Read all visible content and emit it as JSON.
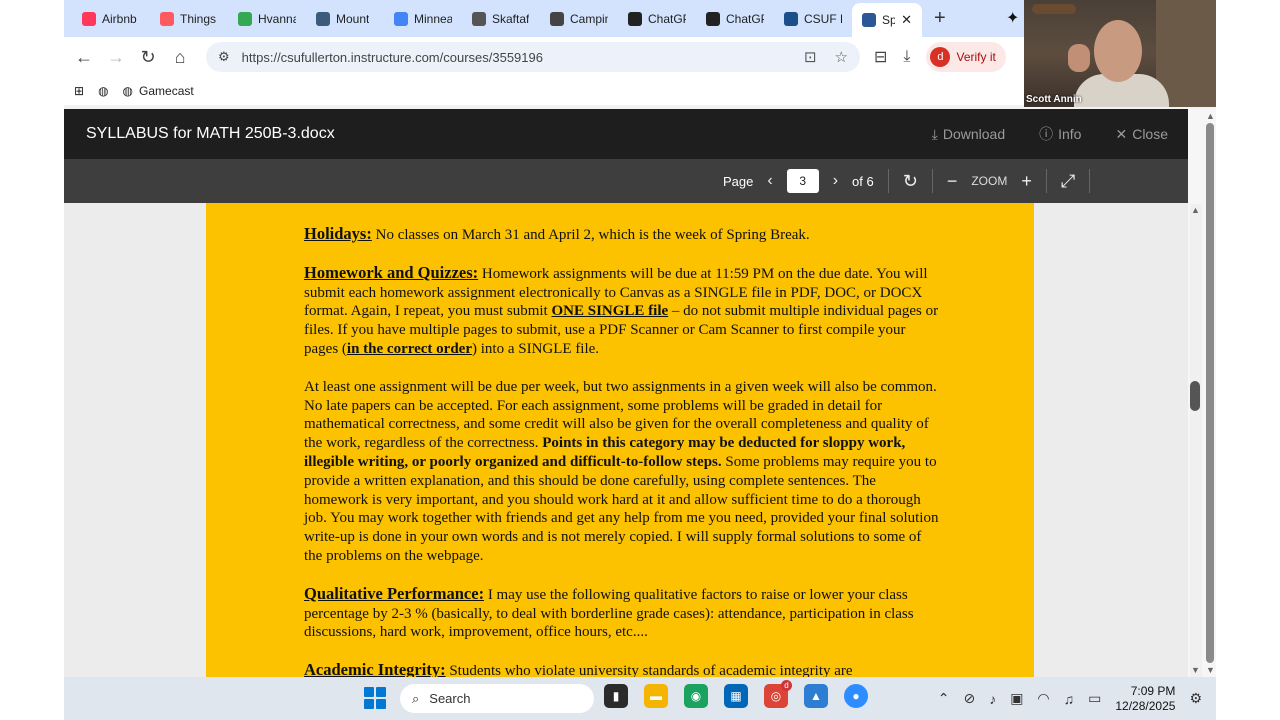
{
  "browser": {
    "tabs": [
      {
        "label": "Airbnb",
        "icon_color": "#ff385c",
        "icon": "airbnb-icon"
      },
      {
        "label": "Things",
        "icon_color": "#ff5a5f",
        "icon": "things-icon"
      },
      {
        "label": "Hvanna",
        "icon_color": "#34a853",
        "icon": "hvanna-icon"
      },
      {
        "label": "Mount",
        "icon_color": "#3b5b7a",
        "icon": "mount-icon"
      },
      {
        "label": "Minnea",
        "icon_color": "#4285f4",
        "icon": "maps-icon"
      },
      {
        "label": "Skaftaf",
        "icon_color": "#555555",
        "icon": "skaftaf-icon"
      },
      {
        "label": "Campin",
        "icon_color": "#444444",
        "icon": "campin-icon"
      },
      {
        "label": "ChatGP",
        "icon_color": "#222222",
        "icon": "chatgpt-icon"
      },
      {
        "label": "ChatGP",
        "icon_color": "#222222",
        "icon": "chatgpt-icon"
      },
      {
        "label": "CSUF P",
        "icon_color": "#1a4f8b",
        "icon": "csuf-icon"
      },
      {
        "label": "Sp",
        "icon_color": "#2b5797",
        "icon": "sp-icon",
        "active": true
      }
    ],
    "url": "https://csufullerton.instructure.com/courses/3559196",
    "verify_label": "Verify it",
    "verify_avatar": "d",
    "bookmarks": [
      {
        "label": "",
        "icon": "apps-icon"
      },
      {
        "label": "",
        "icon": "globe-icon"
      },
      {
        "label": "Gamecast",
        "icon": "gamecast-icon"
      }
    ]
  },
  "viewer": {
    "title": "SYLLABUS for MATH 250B-3.docx",
    "download": "Download",
    "info": "Info",
    "close": "Close",
    "page_label": "Page",
    "page_value": "3",
    "page_of": "of 6",
    "zoom_label": "ZOOM"
  },
  "document": {
    "holidays_head": "Holidays:",
    "holidays_text": " No classes on March 31 and April 2, which is the week of Spring Break.",
    "hw_head": "Homework and Quizzes:",
    "hw_text1": " Homework assignments will be due at 11:59 PM on the due date. You will submit each homework assignment electronically to Canvas as a SINGLE file in PDF, DOC, or DOCX format.  Again, I repeat, you must submit ",
    "hw_bold1": "ONE SINGLE file",
    "hw_text2": " – do not submit multiple individual pages or files.  If you have multiple pages to submit, use a PDF Scanner or Cam Scanner to first compile your pages (",
    "hw_bold2": "in the correct order",
    "hw_text3": ") into a SINGLE file.",
    "p2_text1": "At least one assignment will be due per week, but two assignments in a given week will also be common. No late papers can be accepted. For each assignment, some problems will be graded in detail for mathematical correctness, and some credit will also be given for the overall completeness and quality of the work, regardless of the correctness. ",
    "p2_bold": "Points in this category may be deducted for sloppy work, illegible writing, or poorly organized and difficult-to-follow steps.",
    "p2_text2": "  Some problems may require you to provide a written explanation, and this should be done carefully, using complete sentences.  The homework is very important, and you should work hard at it and allow sufficient time to do a thorough job. You may work together with friends and get any help from me you need, provided your final solution write-up is done in your own words and is not merely copied. I will supply formal solutions to some of the problems on the webpage.",
    "qual_head": "Qualitative Performance:",
    "qual_text": " I may use the following qualitative factors to raise or lower your class percentage by 2-3 % (basically, to deal with borderline grade cases): attendance, participation in class discussions, hard work, improvement, office hours, etc....",
    "ai_head": "Academic Integrity:",
    "ai_text": " Students who violate university standards of academic integrity are"
  },
  "taskbar": {
    "search": "Search",
    "time": "7:09 PM",
    "date": "12/28/2025",
    "chrome_badge": "d"
  },
  "webcam": {
    "name": "Scott Annin"
  }
}
